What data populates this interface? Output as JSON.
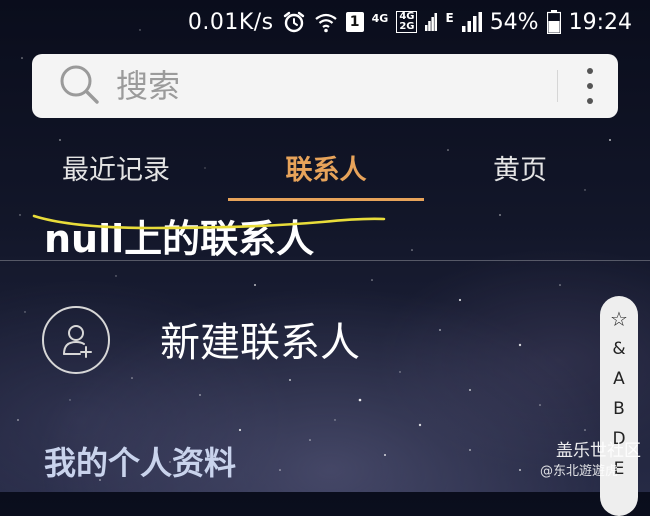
{
  "status_bar": {
    "speed": "0.01K/s",
    "sim_slot": "1",
    "network_4g": "4G",
    "network_4g_top": "4G",
    "network_2g_bottom": "2G",
    "network_e": "E",
    "battery": "54%",
    "time": "19:24"
  },
  "search": {
    "placeholder": "搜索"
  },
  "tabs": [
    {
      "label": "最近记录",
      "active": false
    },
    {
      "label": "联系人",
      "active": true
    },
    {
      "label": "黄页",
      "active": false
    }
  ],
  "section_header": "null上的联系人",
  "new_contact": {
    "label": "新建联系人"
  },
  "my_profile": "我的个人资料",
  "index_strip": [
    "☆",
    "&",
    "A",
    "B",
    "D",
    "E"
  ],
  "watermark": {
    "main": "盖乐世社区",
    "sub": "@东北遊遊虎"
  },
  "colors": {
    "accent": "#e7a35a",
    "strike": "#e8dc3a",
    "profile_text": "#c9d3ec"
  }
}
